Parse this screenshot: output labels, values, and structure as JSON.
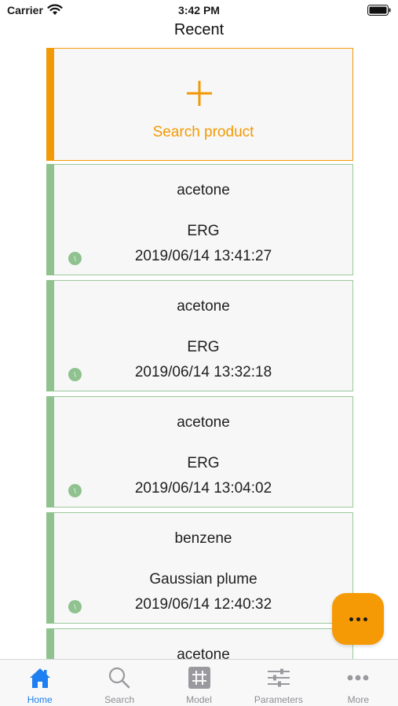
{
  "status_bar": {
    "carrier": "Carrier",
    "time": "3:42 PM"
  },
  "nav": {
    "title": "Recent"
  },
  "search_card": {
    "label": "Search product",
    "accent": "#f29a05"
  },
  "history": [
    {
      "product": "acetone",
      "model": "ERG",
      "timestamp": "2019/06/14 13:41:27"
    },
    {
      "product": "acetone",
      "model": "ERG",
      "timestamp": "2019/06/14 13:32:18"
    },
    {
      "product": "acetone",
      "model": "ERG",
      "timestamp": "2019/06/14 13:04:02"
    },
    {
      "product": "benzene",
      "model": "Gaussian plume",
      "timestamp": "2019/06/14 12:40:32"
    },
    {
      "product": "acetone",
      "model": "",
      "timestamp": ""
    }
  ],
  "history_color": "#8fc28f",
  "fab": {
    "icon": "more-dots-icon",
    "color": "#f59a04"
  },
  "tabs": [
    {
      "label": "Home",
      "icon": "home-icon",
      "active": true
    },
    {
      "label": "Search",
      "icon": "search-icon",
      "active": false
    },
    {
      "label": "Model",
      "icon": "grid-icon",
      "active": false
    },
    {
      "label": "Parameters",
      "icon": "sliders-icon",
      "active": false
    },
    {
      "label": "More",
      "icon": "more-icon",
      "active": false
    }
  ],
  "tab_active_color": "#1e7ff0"
}
